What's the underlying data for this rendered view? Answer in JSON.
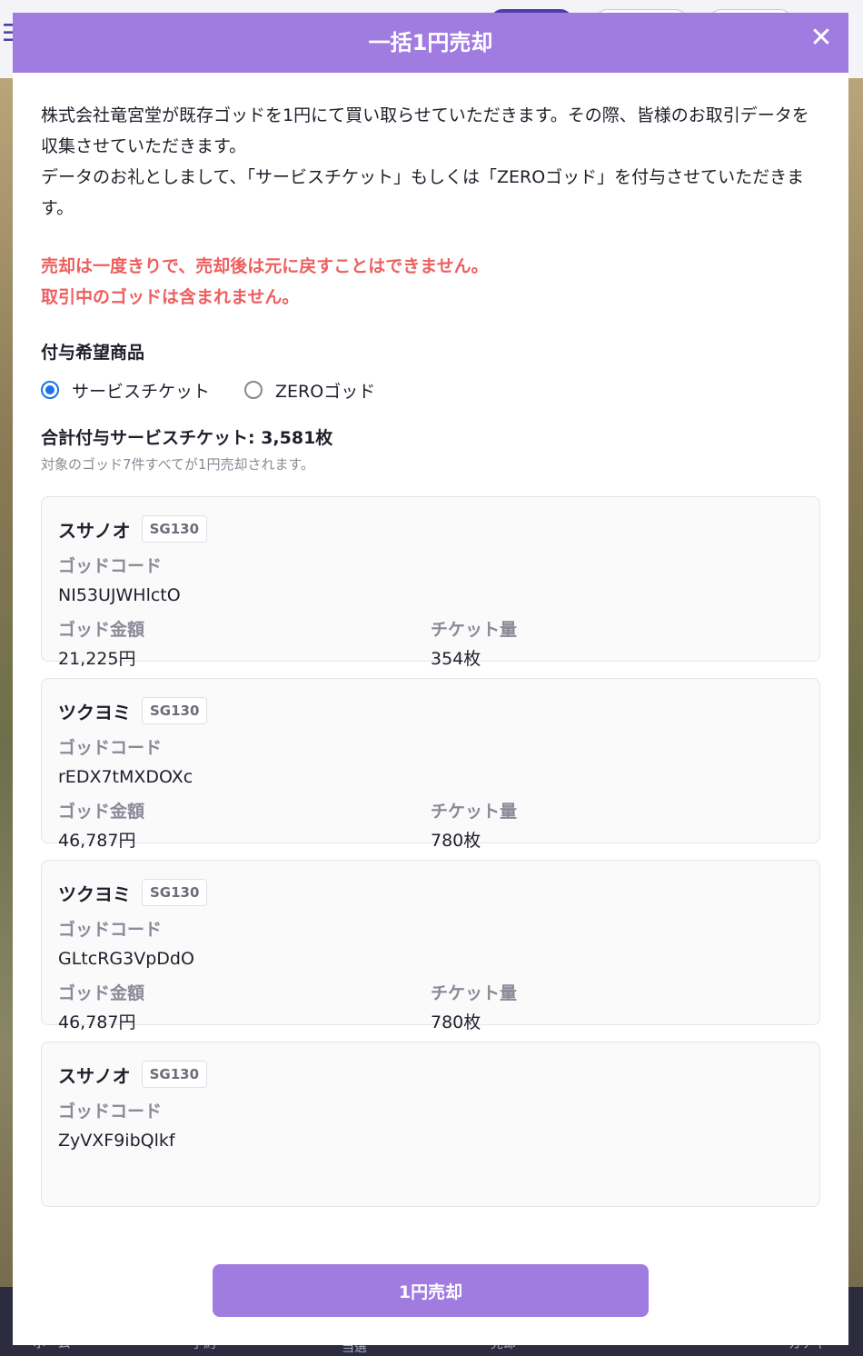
{
  "modal": {
    "title": "一括1円売却",
    "close_icon": "close-icon",
    "intro_line1": "株式会社竜宮堂が既存ゴッドを1円にて買い取らせていただきます。その際、皆様のお取引データを収集させていただきます。",
    "intro_line2": "データのお礼としまして、「サービスチケット」もしくは「ZEROゴッド」を付与させていただきます。",
    "warning_line1": "売却は一度きりで、売却後は元に戻すことはできません。",
    "warning_line2": "取引中のゴッドは含まれません。",
    "reward_title": "付与希望商品",
    "reward_options": [
      {
        "label": "サービスチケット",
        "selected": true
      },
      {
        "label": "ZEROゴッド",
        "selected": false
      }
    ],
    "total_label": "合計付与サービスチケット: 3,581枚",
    "total_sub": "対象のゴッド7件すべてが1円売却されます。",
    "field_labels": {
      "code": "ゴッドコード",
      "amount": "ゴッド金額",
      "tickets": "チケット量"
    },
    "cards": [
      {
        "name": "スサノオ",
        "badge": "SG130",
        "code": "NI53UJWHlctO",
        "amount": "21,225円",
        "tickets": "354枚"
      },
      {
        "name": "ツクヨミ",
        "badge": "SG130",
        "code": "rEDX7tMXDOXc",
        "amount": "46,787円",
        "tickets": "780枚"
      },
      {
        "name": "ツクヨミ",
        "badge": "SG130",
        "code": "GLtcRG3VpDdO",
        "amount": "46,787円",
        "tickets": "780枚"
      },
      {
        "name": "スサノオ",
        "badge": "SG130",
        "code": "ZyVXF9ibQlkf",
        "amount": "",
        "tickets": ""
      }
    ],
    "sell_button": "1円売却"
  },
  "background_nav": [
    "ホーム",
    "予約",
    "当選",
    "売却",
    "",
    "ガチャ"
  ],
  "colors": {
    "header": "#a07be0",
    "button": "#a07be0",
    "warning": "#ee5f5f",
    "radio_selected": "#1a73e8"
  }
}
